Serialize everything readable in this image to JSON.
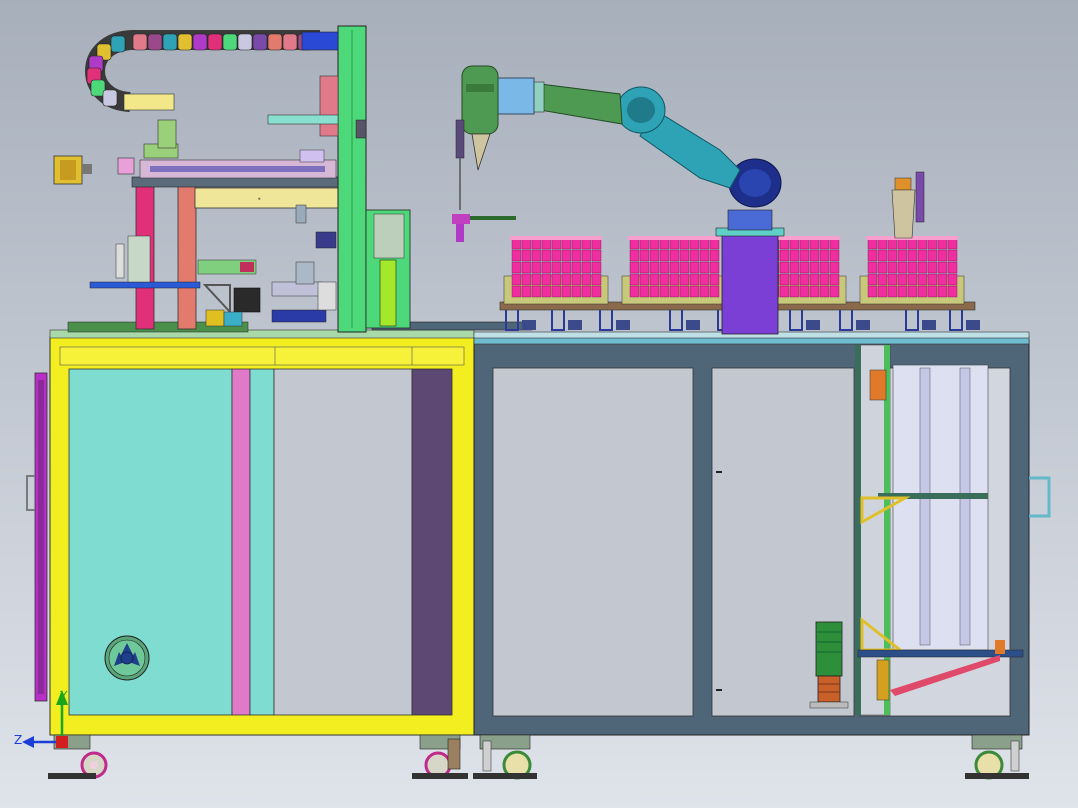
{
  "viewport": {
    "background_top": "#a7afbb",
    "background_bottom": "#dfe3ea"
  },
  "triad": {
    "y_label": "Y",
    "z_label": "Z",
    "y_color": "#1aa51a",
    "z_color": "#1b3fd6",
    "origin_color": "#d21e1e"
  },
  "colors": {
    "yellow_frame": "#f2ee1f",
    "aqua_panel": "#7fdcd0",
    "steel_frame": "#4f6578",
    "gray_panel": "#c3c7cf",
    "green_column": "#4dd97a",
    "pink_tray": "#f02ea0",
    "robot_green": "#4f9a52",
    "robot_blue": "#1d2f8a",
    "robot_teal": "#2ea3b5",
    "purple_pedestal": "#7b3fd6",
    "magenta_post": "#e0307a",
    "salmon_post": "#e27a6d"
  },
  "components": {
    "cable_chain": "cable-carrier",
    "robot": "six-axis-robot-arm",
    "fan": "cooling-fan"
  }
}
